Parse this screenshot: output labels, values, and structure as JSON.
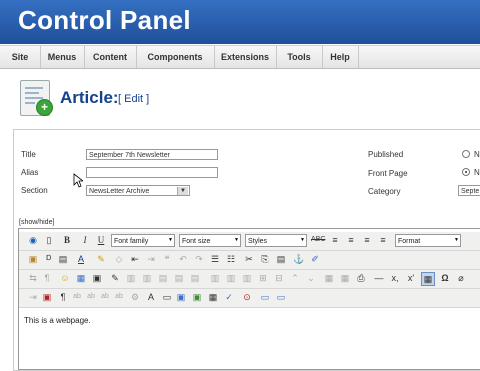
{
  "header": {
    "title": "Control Panel"
  },
  "menu": [
    "Site",
    "Menus",
    "Content",
    "Components",
    "Extensions",
    "Tools",
    "Help"
  ],
  "article": {
    "title": "Article:",
    "edit": "[ Edit ]"
  },
  "form": {
    "title_label": "Title",
    "title_value": "September 7th Newsletter",
    "alias_label": "Alias",
    "alias_value": "",
    "section_label": "Section",
    "section_value": "NewsLetter Archive",
    "published_label": "Published",
    "published_option": "N",
    "frontpage_label": "Front Page",
    "frontpage_option": "N",
    "category_label": "Category",
    "category_value": "Septe"
  },
  "editor": {
    "showhide": "[show/hide]",
    "font_family": "Font family",
    "font_size": "Font size",
    "styles": "Styles",
    "format": "Format",
    "content": "This is a webpage."
  }
}
